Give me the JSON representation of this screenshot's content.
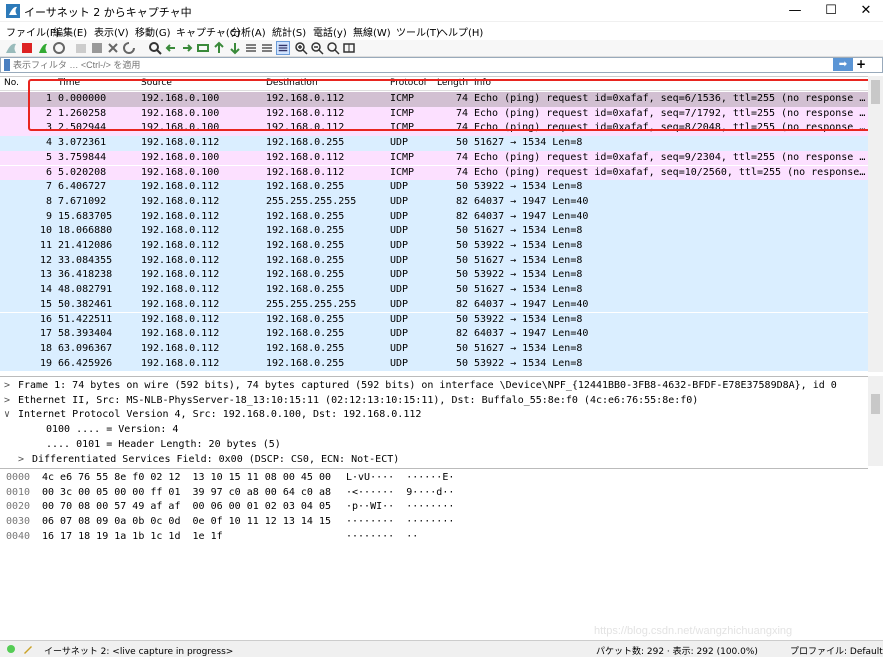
{
  "window": {
    "title": "イーサネット 2 からキャプチャ中",
    "minimize": "—",
    "maximize": "☐",
    "close": "✕"
  },
  "menu": [
    "ファイル(F)",
    "編集(E)",
    "表示(V)",
    "移動(G)",
    "キャプチャ(C)",
    "分析(A)",
    "統計(S)",
    "電話(y)",
    "無線(W)",
    "ツール(T)",
    "ヘルプ(H)"
  ],
  "filter": {
    "placeholder": "表示フィルタ … <Ctrl-/> を適用",
    "arrow": "➡",
    "plus": "+"
  },
  "columns": {
    "no": "No.",
    "time": "Time",
    "source": "Source",
    "destination": "Destination",
    "protocol": "Protocol",
    "length": "Length",
    "info": "Info"
  },
  "packets": [
    {
      "no": "1",
      "time": "0.000000",
      "src": "192.168.0.100",
      "dst": "192.168.0.112",
      "proto": "ICMP",
      "len": "74",
      "info": "Echo (ping) request  id=0xafaf, seq=6/1536, ttl=255 (no response …"
    },
    {
      "no": "2",
      "time": "1.260258",
      "src": "192.168.0.100",
      "dst": "192.168.0.112",
      "proto": "ICMP",
      "len": "74",
      "info": "Echo (ping) request  id=0xafaf, seq=7/1792, ttl=255 (no response …"
    },
    {
      "no": "3",
      "time": "2.502944",
      "src": "192.168.0.100",
      "dst": "192.168.0.112",
      "proto": "ICMP",
      "len": "74",
      "info": "Echo (ping) request  id=0xafaf, seq=8/2048, ttl=255 (no response …"
    },
    {
      "no": "4",
      "time": "3.072361",
      "src": "192.168.0.112",
      "dst": "192.168.0.255",
      "proto": "UDP",
      "len": "50",
      "info": "51627 → 1534 Len=8"
    },
    {
      "no": "5",
      "time": "3.759844",
      "src": "192.168.0.100",
      "dst": "192.168.0.112",
      "proto": "ICMP",
      "len": "74",
      "info": "Echo (ping) request  id=0xafaf, seq=9/2304, ttl=255 (no response …"
    },
    {
      "no": "6",
      "time": "5.020208",
      "src": "192.168.0.100",
      "dst": "192.168.0.112",
      "proto": "ICMP",
      "len": "74",
      "info": "Echo (ping) request  id=0xafaf, seq=10/2560, ttl=255 (no response…"
    },
    {
      "no": "7",
      "time": "6.406727",
      "src": "192.168.0.112",
      "dst": "192.168.0.255",
      "proto": "UDP",
      "len": "50",
      "info": "53922 → 1534 Len=8"
    },
    {
      "no": "8",
      "time": "7.671092",
      "src": "192.168.0.112",
      "dst": "255.255.255.255",
      "proto": "UDP",
      "len": "82",
      "info": "64037 → 1947 Len=40"
    },
    {
      "no": "9",
      "time": "15.683705",
      "src": "192.168.0.112",
      "dst": "192.168.0.255",
      "proto": "UDP",
      "len": "82",
      "info": "64037 → 1947 Len=40"
    },
    {
      "no": "10",
      "time": "18.066880",
      "src": "192.168.0.112",
      "dst": "192.168.0.255",
      "proto": "UDP",
      "len": "50",
      "info": "51627 → 1534 Len=8"
    },
    {
      "no": "11",
      "time": "21.412086",
      "src": "192.168.0.112",
      "dst": "192.168.0.255",
      "proto": "UDP",
      "len": "50",
      "info": "53922 → 1534 Len=8"
    },
    {
      "no": "12",
      "time": "33.084355",
      "src": "192.168.0.112",
      "dst": "192.168.0.255",
      "proto": "UDP",
      "len": "50",
      "info": "51627 → 1534 Len=8"
    },
    {
      "no": "13",
      "time": "36.418238",
      "src": "192.168.0.112",
      "dst": "192.168.0.255",
      "proto": "UDP",
      "len": "50",
      "info": "53922 → 1534 Len=8"
    },
    {
      "no": "14",
      "time": "48.082791",
      "src": "192.168.0.112",
      "dst": "192.168.0.255",
      "proto": "UDP",
      "len": "50",
      "info": "51627 → 1534 Len=8"
    },
    {
      "no": "15",
      "time": "50.382461",
      "src": "192.168.0.112",
      "dst": "255.255.255.255",
      "proto": "UDP",
      "len": "82",
      "info": "64037 → 1947 Len=40"
    },
    {
      "no": "16",
      "time": "51.422511",
      "src": "192.168.0.112",
      "dst": "192.168.0.255",
      "proto": "UDP",
      "len": "50",
      "info": "53922 → 1534 Len=8"
    },
    {
      "no": "17",
      "time": "58.393404",
      "src": "192.168.0.112",
      "dst": "192.168.0.255",
      "proto": "UDP",
      "len": "82",
      "info": "64037 → 1947 Len=40"
    },
    {
      "no": "18",
      "time": "63.096367",
      "src": "192.168.0.112",
      "dst": "192.168.0.255",
      "proto": "UDP",
      "len": "50",
      "info": "51627 → 1534 Len=8"
    },
    {
      "no": "19",
      "time": "66.425926",
      "src": "192.168.0.112",
      "dst": "192.168.0.255",
      "proto": "UDP",
      "len": "50",
      "info": "53922 → 1534 Len=8"
    }
  ],
  "details": [
    {
      "expander": ">",
      "text": "Frame 1: 74 bytes on wire (592 bits), 74 bytes captured (592 bits) on interface \\Device\\NPF_{12441BB0-3FB8-4632-BFDF-E78E37589D8A}, id 0"
    },
    {
      "expander": ">",
      "text": "Ethernet II, Src: MS-NLB-PhysServer-18_13:10:15:11 (02:12:13:10:15:11), Dst: Buffalo_55:8e:f0 (4c:e6:76:55:8e:f0)"
    },
    {
      "expander": "∨",
      "text": "Internet Protocol Version 4, Src: 192.168.0.100, Dst: 192.168.0.112"
    },
    {
      "expander": "",
      "text": "0100 .... = Version: 4"
    },
    {
      "expander": "",
      "text": ".... 0101 = Header Length: 20 bytes (5)"
    },
    {
      "expander": ">",
      "text": "Differentiated Services Field: 0x00 (DSCP: CS0, ECN: Not-ECT)"
    }
  ],
  "bytes": [
    {
      "offset": "0000",
      "hex": "4c e6 76 55 8e f0 02 12  13 10 15 11 08 00 45 00",
      "ascii": "L·vU····  ······E·"
    },
    {
      "offset": "0010",
      "hex": "00 3c 00 05 00 00 ff 01  39 97 c0 a8 00 64 c0 a8",
      "ascii": "·<······  9····d··"
    },
    {
      "offset": "0020",
      "hex": "00 70 08 00 57 49 af af  00 06 00 01 02 03 04 05",
      "ascii": "·p··WI··  ········"
    },
    {
      "offset": "0030",
      "hex": "06 07 08 09 0a 0b 0c 0d  0e 0f 10 11 12 13 14 15",
      "ascii": "········  ········"
    },
    {
      "offset": "0040",
      "hex": "16 17 18 19 1a 1b 1c 1d  1e 1f",
      "ascii": "········  ··"
    }
  ],
  "status": {
    "interface": "イーサネット 2: <live capture in progress>",
    "packets": "パケット数: 292 · 表示: 292 (100.0%)",
    "profile": "プロファイル: Default"
  },
  "colors": {
    "icmp_row": "#fce0ff",
    "udp_row": "#daeeff",
    "selected_row": "#d2c0d2",
    "highlight_box": "#e8251f"
  },
  "watermark": "https://blog.csdn.net/wangzhichuangxing"
}
